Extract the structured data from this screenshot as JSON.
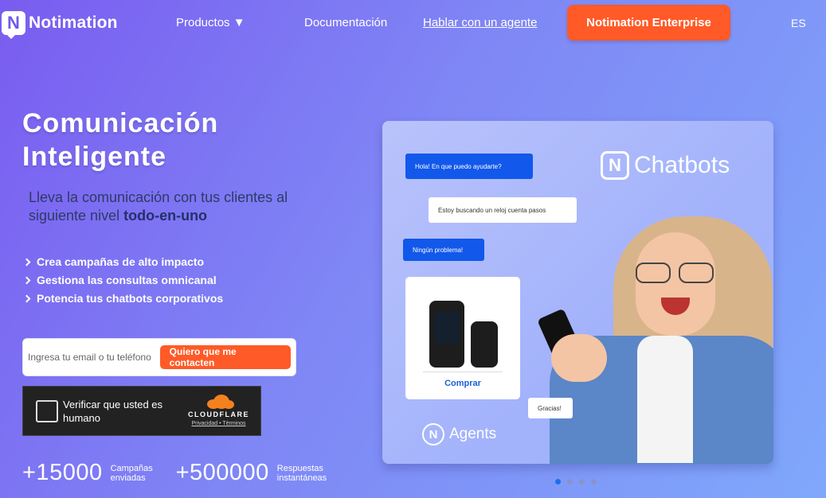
{
  "header": {
    "logo_text": "Notimation",
    "logo_letter": "N",
    "nav_products": "Productos ▼",
    "nav_docs": "Documentación",
    "nav_agent": "Hablar con un agente",
    "enterprise_button": "Notimation Enterprise",
    "language": "ES"
  },
  "hero": {
    "title_line1": "Comunicación",
    "title_line2": "Inteligente",
    "subtitle_part1": "Lleva la comunicación con tus clientes al siguiente nivel",
    "subtitle_bold": "todo-en-uno",
    "bullets": [
      "Crea campañas de alto impacto",
      "Gestiona las consultas omnicanal",
      "Potencia tus chatbots corporativos"
    ]
  },
  "contact_form": {
    "placeholder": "Ingresa tu email o tu teléfono",
    "button": "Quiero que me contacten"
  },
  "captcha": {
    "label": "Verificar que usted es humano",
    "brand": "CLOUDFLARE",
    "privacy": "Privacidad",
    "separator": " • ",
    "terms": "Términos"
  },
  "stats": [
    {
      "value": "+15000",
      "label": "Campañas enviadas"
    },
    {
      "value": "+500000",
      "label": "Respuestas instantáneas"
    }
  ],
  "showcase": {
    "chatbots_label": "Chatbots",
    "agents_label": "Agents",
    "bubble1": "Hola! En que puedo ayudarte?",
    "bubble2": "Estoy buscando un reloj cuenta pasos",
    "bubble3": "Ningún problema!",
    "bubble4": "Gracias!",
    "buy_button": "Comprar"
  },
  "carousel": {
    "slides": 4,
    "active": 0
  },
  "colors": {
    "accent": "#ff5a27",
    "chat_blue": "#1258ea",
    "dot_active": "#1e6ef0"
  }
}
